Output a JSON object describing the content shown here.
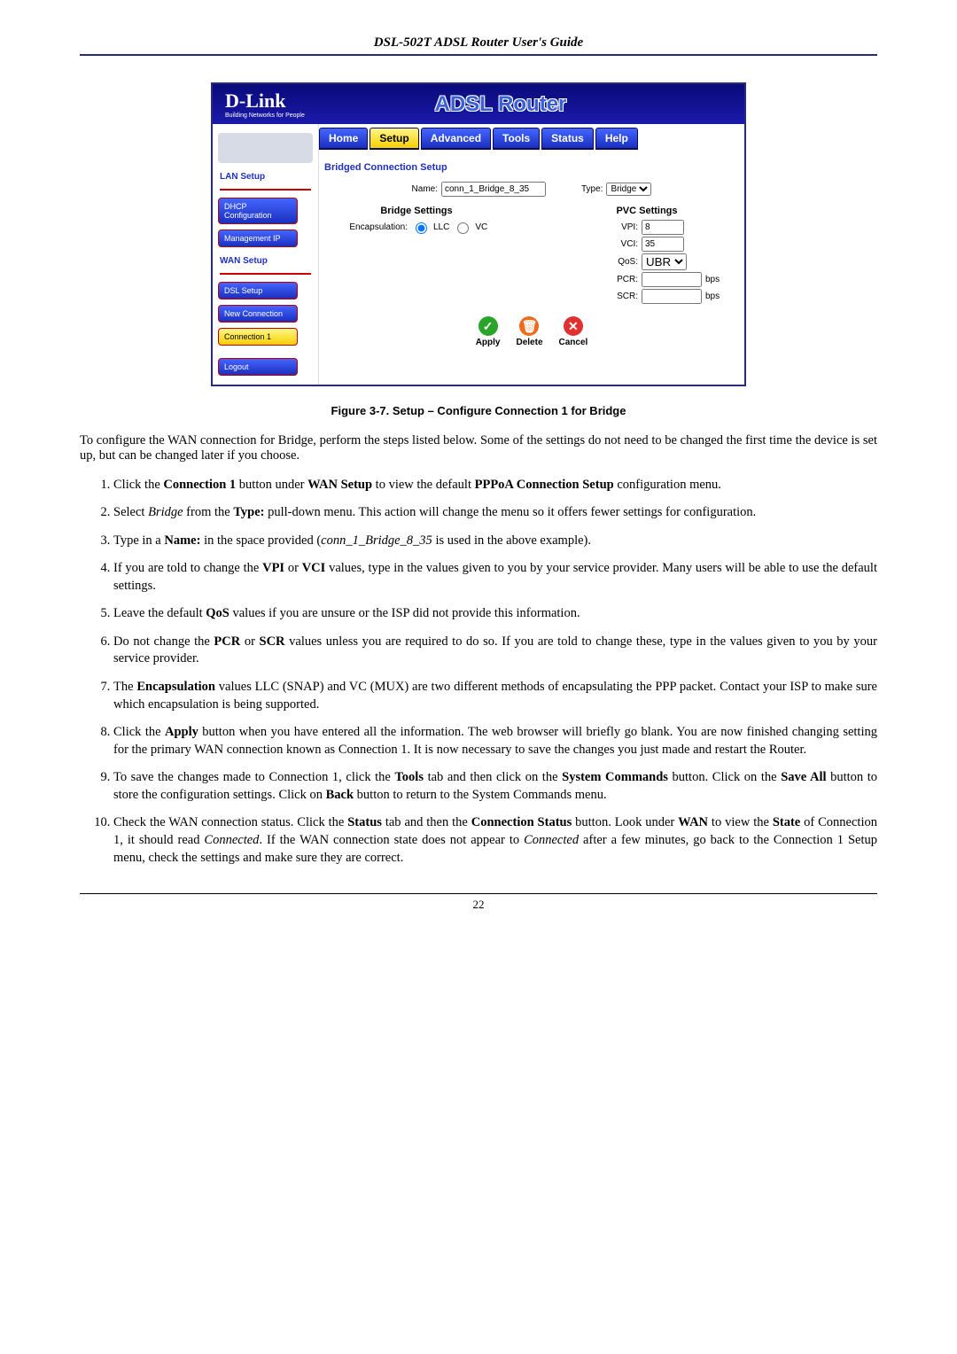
{
  "doc": {
    "header": "DSL-502T ADSL Router User's Guide",
    "page_number": "22"
  },
  "screenshot": {
    "logo": {
      "brand": "D-Link",
      "tagline": "Building Networks for People"
    },
    "product_title": "ADSL Router",
    "tabs": [
      "Home",
      "Setup",
      "Advanced",
      "Tools",
      "Status",
      "Help"
    ],
    "active_tab": 1,
    "sidebar": {
      "groups": [
        {
          "heading": "LAN Setup",
          "items": [
            {
              "label": "DHCP Configuration",
              "style": "std"
            },
            {
              "label": "Management IP",
              "style": "std"
            }
          ]
        },
        {
          "heading": "WAN Setup",
          "items": [
            {
              "label": "DSL Setup",
              "style": "std"
            },
            {
              "label": "New Connection",
              "style": "std"
            },
            {
              "label": "Connection 1",
              "style": "alt"
            }
          ]
        }
      ],
      "logout": "Logout"
    },
    "panel": {
      "title": "Bridged Connection Setup",
      "name_label": "Name:",
      "name_value": "conn_1_Bridge_8_35",
      "type_label": "Type:",
      "type_value": "Bridge",
      "bridge": {
        "heading": "Bridge Settings",
        "encap_label": "Encapsulation:",
        "encap_options": [
          "LLC",
          "VC"
        ],
        "encap_selected": "LLC"
      },
      "pvc": {
        "heading": "PVC Settings",
        "vpi_label": "VPI:",
        "vpi_value": "8",
        "vci_label": "VCI:",
        "vci_value": "35",
        "qos_label": "QoS:",
        "qos_value": "UBR",
        "pcr_label": "PCR:",
        "pcr_value": "",
        "pcr_unit": "bps",
        "scr_label": "SCR:",
        "scr_value": "",
        "scr_unit": "bps"
      },
      "actions": {
        "apply": "Apply",
        "delete": "Delete",
        "cancel": "Cancel"
      }
    }
  },
  "figure_caption": "Figure 3-7. Setup – Configure Connection 1 for Bridge",
  "intro": "To configure the WAN connection for Bridge, perform the steps listed below. Some of the settings do not need to be changed the first time the device is set up, but can be changed later if you choose.",
  "steps": [
    {
      "pre": "Click the ",
      "b1": "Connection 1",
      "mid1": " button under ",
      "b2": "WAN Setup",
      "mid2": " to view the default ",
      "b3": "PPPoA Connection Setup",
      "post": " configuration menu."
    },
    {
      "pre": "Select ",
      "i1": "Bridge",
      "mid1": " from the ",
      "b1": "Type:",
      "post": " pull-down menu. This action will change the menu so it offers fewer settings for configuration."
    },
    {
      "pre": "Type in a ",
      "b1": "Name:",
      "mid1": " in the space provided (",
      "i1": "conn_1_Bridge_8_35",
      "post": " is used in the above example)."
    },
    {
      "pre": "If you are told to change the ",
      "b1": "VPI",
      "mid1": " or ",
      "b2": "VCI",
      "post": " values, type in the values given to you by your service provider. Many users will be able to use the default settings."
    },
    {
      "pre": "Leave the default ",
      "b1": "QoS",
      "post": " values if you are unsure or the ISP did not provide this information."
    },
    {
      "pre": "Do not change the ",
      "b1": "PCR",
      "mid1": " or ",
      "b2": "SCR",
      "post": " values unless you are required to do so. If you are told to change these, type in the values given to you by your service provider."
    },
    {
      "pre": "The ",
      "b1": "Encapsulation",
      "post": " values LLC (SNAP) and VC (MUX) are two different methods of encapsulating the PPP packet. Contact your ISP to make sure which encapsulation is being supported."
    },
    {
      "pre": "Click the ",
      "b1": "Apply",
      "post": " button when you have entered all the information. The web browser will briefly go blank. You are now finished changing setting for the primary WAN connection known as Connection 1. It is now necessary to save the changes you just made and restart the Router."
    },
    {
      "pre": "To save the changes made to Connection 1, click the ",
      "b1": "Tools",
      "mid1": " tab and then click on the ",
      "b2": "System Commands",
      "mid2": " button. Click on the ",
      "b3": "Save All",
      "mid3": " button to store the configuration settings. Click on ",
      "b4": "Back",
      "post": " button to return to the System Commands menu."
    },
    {
      "pre": "Check the WAN connection status. Click the ",
      "b1": "Status",
      "mid1": " tab and then the ",
      "b2": "Connection Status",
      "mid2": " button. Look under ",
      "b3": "WAN",
      "mid3": " to view the ",
      "b4": "State",
      "mid4": " of Connection 1, it should read ",
      "i1": "Connected",
      "mid5": ". If the WAN connection state does not appear to ",
      "i2": "Connected",
      "post": " after a few minutes, go back to the Connection 1 Setup menu, check the settings and make sure they are correct."
    }
  ]
}
